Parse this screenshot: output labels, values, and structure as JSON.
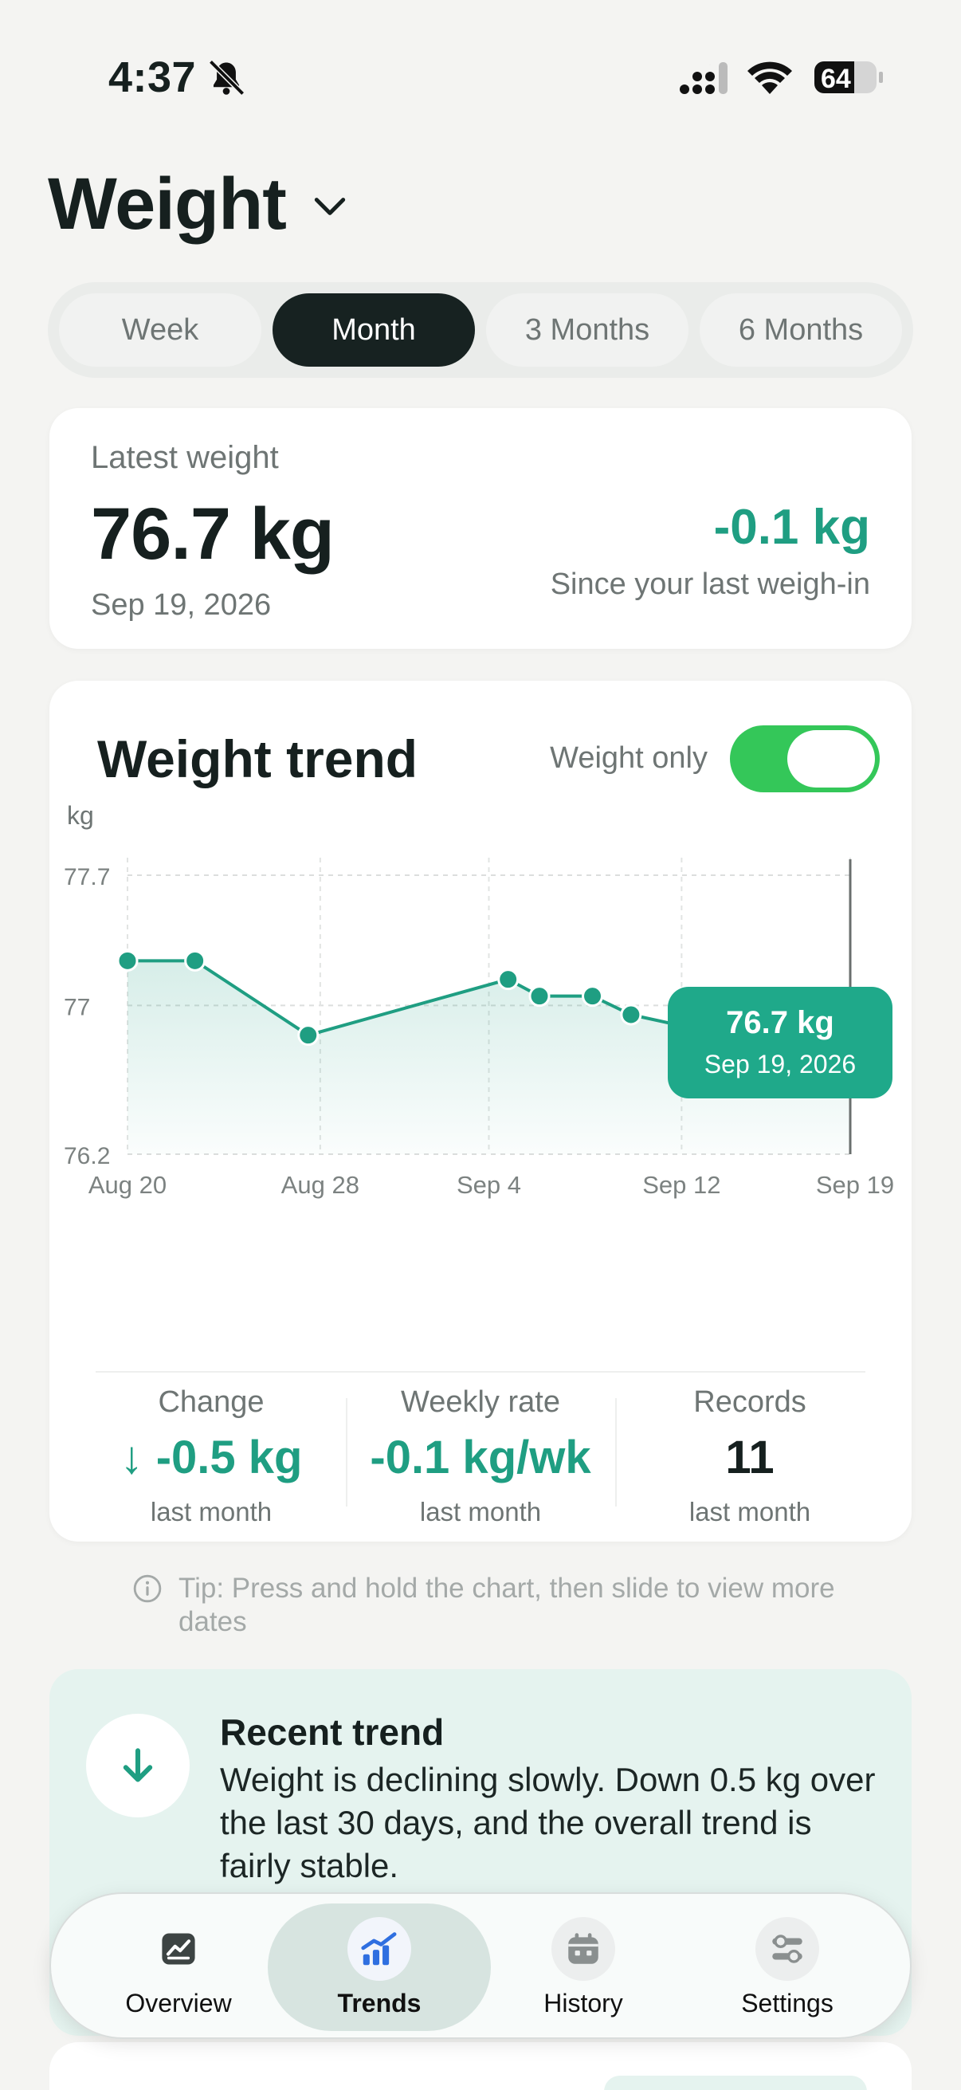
{
  "status_bar": {
    "time": "4:37",
    "battery": "64"
  },
  "header": {
    "title": "Weight"
  },
  "range_tabs": [
    {
      "label": "Week",
      "active": false
    },
    {
      "label": "Month",
      "active": true
    },
    {
      "label": "3 Months",
      "active": false
    },
    {
      "label": "6 Months",
      "active": false
    }
  ],
  "latest": {
    "label": "Latest weight",
    "value": "76.7 kg",
    "date": "Sep 19, 2026",
    "delta": "-0.1 kg",
    "since": "Since your last weigh-in"
  },
  "trend": {
    "title": "Weight trend",
    "toggle_label": "Weight only",
    "toggle_on": true
  },
  "chart_data": {
    "type": "area",
    "ylabel": "kg",
    "yticks": [
      "77.7",
      "77",
      "76.2"
    ],
    "ylim": [
      76.2,
      77.7
    ],
    "xticks": [
      "Aug 20",
      "Aug 28",
      "Sep 4",
      "Sep 12",
      "Sep 19"
    ],
    "x_tick_days": [
      20,
      28,
      35,
      43,
      50
    ],
    "points": [
      {
        "day": 20,
        "y": 77.24
      },
      {
        "day": 22.8,
        "y": 77.24
      },
      {
        "day": 27.5,
        "y": 76.84
      },
      {
        "day": 35.8,
        "y": 77.14
      },
      {
        "day": 37.1,
        "y": 77.05
      },
      {
        "day": 39.3,
        "y": 77.05
      },
      {
        "day": 40.9,
        "y": 76.95
      },
      {
        "day": 44.8,
        "y": 76.84
      },
      {
        "day": 45.8,
        "y": 76.84
      },
      {
        "day": 50,
        "y": 76.74
      }
    ],
    "tooltip": {
      "value": "76.7 kg",
      "date": "Sep 19, 2026"
    },
    "line_color": "#1f9e82",
    "grid": true
  },
  "stats": [
    {
      "label": "Change",
      "value": "-0.5 kg",
      "sub": "last month",
      "arrow": "↓"
    },
    {
      "label": "Weekly rate",
      "value": "-0.1 kg/wk",
      "sub": "last month"
    },
    {
      "label": "Records",
      "value": "11",
      "sub": "last month"
    }
  ],
  "tip": "Tip: Press and hold the chart, then slide to view more dates",
  "recent": {
    "title": "Recent trend",
    "body": "Weight is declining slowly. Down 0.5 kg over the last 30 days, and the overall trend is fairly stable."
  },
  "tab_bar": [
    {
      "label": "Overview",
      "icon": "overview-icon",
      "active": false
    },
    {
      "label": "Trends",
      "icon": "trends-icon",
      "active": true
    },
    {
      "label": "History",
      "icon": "history-icon",
      "active": false
    },
    {
      "label": "Settings",
      "icon": "settings-icon",
      "active": false
    }
  ]
}
